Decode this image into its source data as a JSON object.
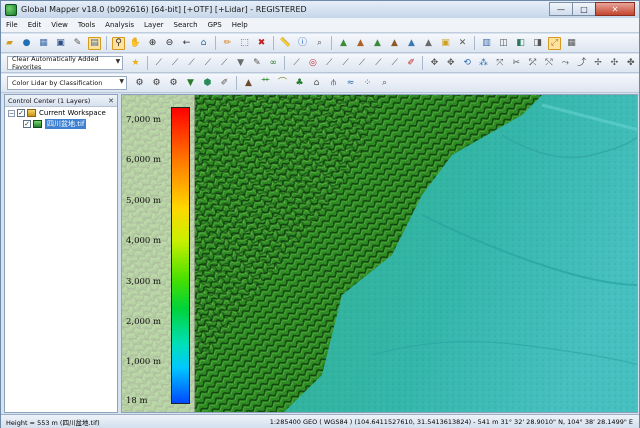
{
  "window": {
    "title": "Global Mapper v18.0 (b092616) [64-bit] [+OTF] [+Lidar] - REGISTERED",
    "controls": {
      "minimize": "—",
      "maximize": "□",
      "close": "✕"
    }
  },
  "menu": [
    "File",
    "Edit",
    "View",
    "Tools",
    "Analysis",
    "Layer",
    "Search",
    "GPS",
    "Help"
  ],
  "toolbar": {
    "row1_icons": [
      "open-folder",
      "globe",
      "table",
      "save",
      "wrench",
      "layers",
      "zoom-tool",
      "pan-tool",
      "zoom-in",
      "zoom-out",
      "back-arrow",
      "home",
      "pencil",
      "select-box",
      "delete",
      "measure",
      "info",
      "search-map",
      "terrain-1",
      "terrain-2",
      "terrain-3",
      "terrain-4",
      "terrain-5",
      "terrain-6",
      "image",
      "satellite",
      "window-1",
      "window-2",
      "window-3",
      "window-4",
      "window-5",
      "window-6"
    ],
    "favorites_combo": "Clear Automatically Added Favorites",
    "lidar_combo": "Color Lidar by Classification"
  },
  "control_center": {
    "title": "Control Center (1 Layers)",
    "close": "✕",
    "workspace_label": "Current Workspace",
    "layer_label": "四川盆地.tif"
  },
  "legend": {
    "labels": [
      "7,000 m",
      "6,000 m",
      "5,000 m",
      "4,000 m",
      "3,000 m",
      "2,000 m",
      "1,000 m",
      "18 m"
    ]
  },
  "status": {
    "left": "Height = 553 m (四川盆地.tif)",
    "right": "1:285400   GEO ( WGS84 ) (104.6411527610, 31.5413613824) - 541 m   31° 32' 28.9010\" N, 104° 38' 28.1499\" E"
  }
}
